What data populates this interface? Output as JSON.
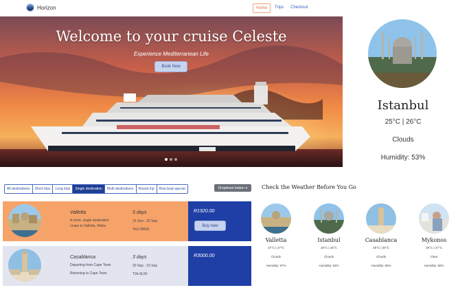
{
  "navbar": {
    "brand": "Horizon",
    "links": [
      {
        "label": "Home",
        "active": true
      },
      {
        "label": "Trips",
        "active": false
      },
      {
        "label": "Checkout",
        "active": false
      }
    ]
  },
  "hero": {
    "title": "Welcome to your cruise Celeste",
    "subtitle": "Experience Mediterranean Life",
    "button": "Book Now",
    "slide_count": 3,
    "active_slide": 1
  },
  "weather_main": {
    "city": "Istanbul",
    "temp": "25°C | 26°C",
    "condition": "Clouds",
    "humidity": "Humidity: 53%"
  },
  "filters": {
    "tabs": [
      "All destinations",
      "Short trips",
      "Long trips",
      "Single destination",
      "Multi destinations",
      "Round trip",
      "Row boat special"
    ],
    "active_index": 3,
    "dropdown_label": "Dropdown button"
  },
  "trips": [
    {
      "name": "Valletta",
      "description": "A short, single destination cruise to Valletta, Malta.",
      "days": "5 days",
      "dates": "15 Sep - 20 Sep",
      "code": "Tw2-99Rdl",
      "price": "R1920.00",
      "button": "Buy now",
      "card_color": "#f6a36a"
    },
    {
      "name": "Casablanca",
      "description": "Departing from Cape Town",
      "description2": "Returning to Cape Town",
      "days": "3 days",
      "dates": "20 Sep - 23 Sep",
      "code": "T2b-9L50",
      "price": "R3000.00",
      "card_color": "#e2e5f0"
    }
  ],
  "weather_strip": {
    "heading": "Check the Weather Before You Go",
    "cities": [
      {
        "city": "Valletta",
        "temp": "27°C | 27°C",
        "condition": "Clouds",
        "humidity": "Humidity: 57%"
      },
      {
        "city": "Istanbul",
        "temp": "26°C | 26°C",
        "condition": "Clouds",
        "humidity": "Humidity: 53%"
      },
      {
        "city": "Casablanca",
        "temp": "29°C | 30°C",
        "condition": "Clouds",
        "humidity": "Humidity: 65%"
      },
      {
        "city": "Mykonos",
        "temp": "26°C | 27°C",
        "condition": "Clear",
        "humidity": "Humidity: 65%"
      }
    ]
  },
  "colors": {
    "accent_blue": "#1f3fa6",
    "orange": "#f6a36a",
    "nav_active": "#e76f3c"
  }
}
